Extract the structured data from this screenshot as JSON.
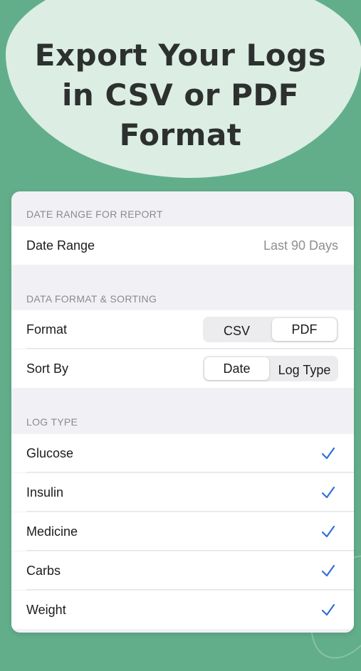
{
  "headline": [
    "Export Your Logs",
    "in CSV or PDF",
    "Format"
  ],
  "sections": {
    "date_range_header": "DATE RANGE FOR REPORT",
    "data_format_header": "DATA FORMAT & SORTING",
    "log_type_header": "LOG TYPE"
  },
  "date_range": {
    "label": "Date Range",
    "value": "Last 90 Days"
  },
  "format": {
    "label": "Format",
    "options": [
      "CSV",
      "PDF"
    ],
    "selected": "PDF"
  },
  "sort_by": {
    "label": "Sort By",
    "options": [
      "Date",
      "Log Type"
    ],
    "selected": "Date"
  },
  "log_types": [
    {
      "label": "Glucose",
      "checked": true
    },
    {
      "label": "Insulin",
      "checked": true
    },
    {
      "label": "Medicine",
      "checked": true
    },
    {
      "label": "Carbs",
      "checked": true
    },
    {
      "label": "Weight",
      "checked": true
    }
  ],
  "colors": {
    "background": "#62ae8b",
    "accent": "#2f6fd6",
    "blob": "#dcede4"
  },
  "icons": {
    "check": "checkmark-icon"
  }
}
